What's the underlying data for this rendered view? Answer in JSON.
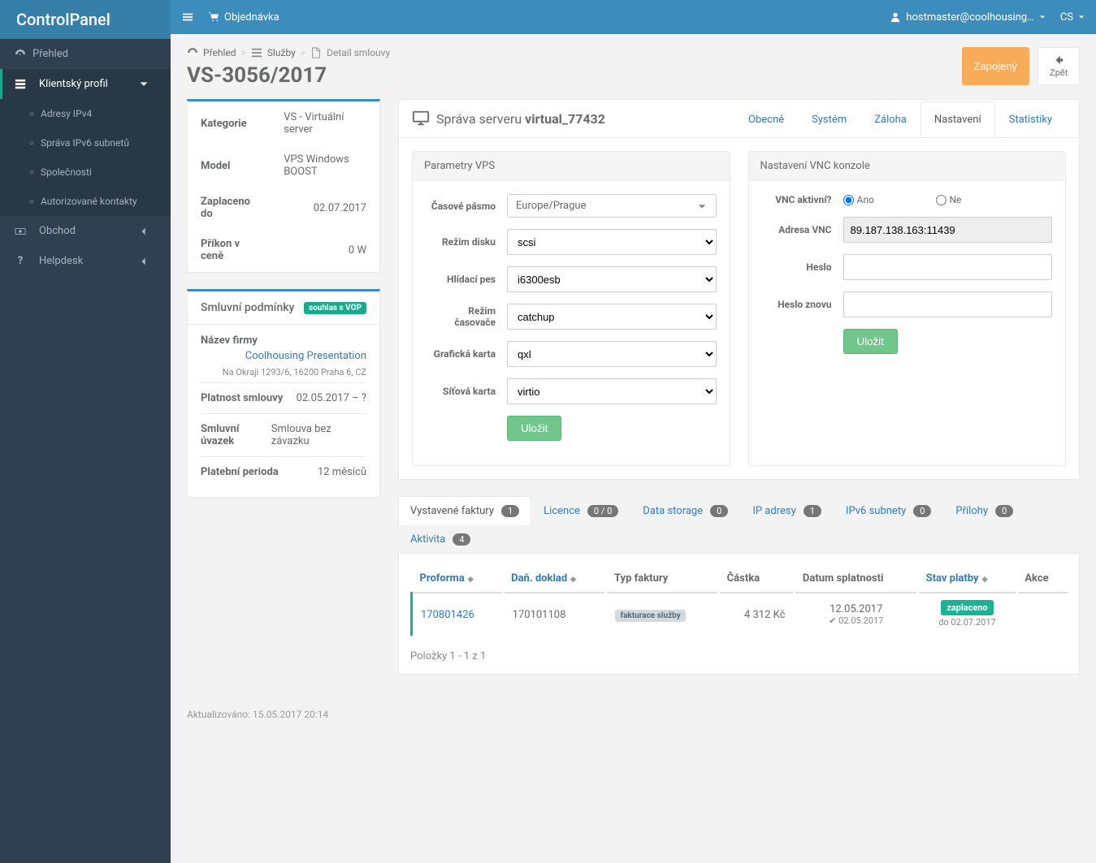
{
  "brand": "ControlPanel",
  "topbar": {
    "order": "Objednávka",
    "user": "hostmaster@coolhousing…",
    "lang": "CS"
  },
  "breadcrumb": {
    "overview": "Přehled",
    "services": "Služby",
    "detail": "Detail smlouvy"
  },
  "page_title": "VS-3056/2017",
  "actions": {
    "status": "Zapojený",
    "back": "Zpět"
  },
  "sidebar": {
    "overview": "Přehled",
    "client": "Klientský profil",
    "sub": [
      "Adresy IPv4",
      "Správa IPv6 subnetů",
      "Společnosti",
      "Autorizované kontakty"
    ],
    "shop": "Obchod",
    "help": "Helpdesk"
  },
  "info": {
    "rows": [
      {
        "k": "Kategorie",
        "v": "VS - Virtuální server"
      },
      {
        "k": "Model",
        "v": "VPS Windows BOOST"
      },
      {
        "k": "Zaplaceno do",
        "v": "02.07.2017"
      },
      {
        "k": "Příkon v ceně",
        "v": "0 W"
      }
    ]
  },
  "terms": {
    "title": "Smluvní podmínky",
    "badge": "souhlas s VOP",
    "company_label": "Název firmy",
    "company_link": "Coolhousing Presentation",
    "company_addr": "Na Okraji 1293/6, 16200 Praha 6, CZ",
    "rows": [
      {
        "k": "Platnost smlouvy",
        "v": "02.05.2017 – ?"
      },
      {
        "k": "Smluvní úvazek",
        "v": "Smlouva bez závazku"
      },
      {
        "k": "Platební perioda",
        "v": "12 měsíců"
      }
    ]
  },
  "server": {
    "title_prefix": "Správa serveru",
    "name": "virtual_77432",
    "tabs": [
      "Obecné",
      "Systém",
      "Záloha",
      "Nastavení",
      "Statistiky"
    ],
    "active_tab": 3,
    "vps": {
      "title": "Parametry VPS",
      "tz_label": "Časové pásmo",
      "tz_value": "Europe/Prague",
      "disk_label": "Režim disku",
      "disk_value": "scsi",
      "watch_label": "Hlídací pes",
      "watch_value": "i6300esb",
      "timer_label": "Režim časovače",
      "timer_value": "catchup",
      "gpu_label": "Grafická karta",
      "gpu_value": "qxl",
      "nic_label": "Síťová karta",
      "nic_value": "virtio",
      "save": "Uložit"
    },
    "vnc": {
      "title": "Nastavení VNC konzole",
      "active_label": "VNC aktivní?",
      "yes": "Ano",
      "no": "Ne",
      "addr_label": "Adresa VNC",
      "addr_value": "89.187.138.163:11439",
      "pass_label": "Heslo",
      "pass2_label": "Heslo znovu",
      "save": "Uložit"
    }
  },
  "subtabs": [
    {
      "label": "Vystavené faktury",
      "badge": "1"
    },
    {
      "label": "Licence",
      "badge": "0 / 0"
    },
    {
      "label": "Data storage",
      "badge": "0"
    },
    {
      "label": "IP adresy",
      "badge": "1"
    },
    {
      "label": "IPv6 subnety",
      "badge": "0"
    },
    {
      "label": "Přílohy",
      "badge": "0"
    },
    {
      "label": "Aktivita",
      "badge": "4"
    }
  ],
  "invoices": {
    "headers": [
      "Proforma",
      "Daň. doklad",
      "Typ faktury",
      "Částka",
      "Datum splatnosti",
      "Stav platby",
      "Akce"
    ],
    "rows": [
      {
        "proforma": "170801426",
        "doc": "170101108",
        "type": "fakturace služby",
        "amount": "4 312 Kč",
        "due": "12.05.2017",
        "paid_on": "02.05.2017",
        "status": "zaplaceno",
        "until": "do 02.07.2017"
      }
    ],
    "footer": "Položky 1 - 1 z 1"
  },
  "page_footer": "Aktualizováno: 15.05.2017 20:14"
}
